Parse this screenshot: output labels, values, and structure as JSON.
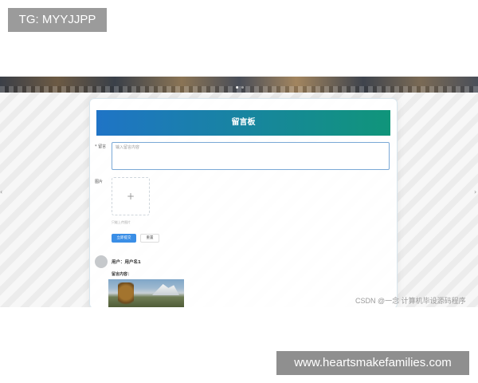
{
  "overlay": {
    "tg_label": "TG: MYYJJPP",
    "site_label": "www.heartsmakefamilies.com"
  },
  "screenshot": {
    "header_title": "留言板",
    "form": {
      "message_label": "* 留言",
      "message_placeholder": "输入留言内容",
      "image_label": "图片",
      "upload_plus": "+",
      "upload_tip": "只能上传图片",
      "submit_label": "立即提交",
      "reset_label": "重置"
    },
    "post": {
      "user_name": "用户：用户名1",
      "content_label": "留言内容：",
      "image_icon": "landscape-photo"
    },
    "watermark": "CSDN @一念 计算机毕设源码程序"
  }
}
